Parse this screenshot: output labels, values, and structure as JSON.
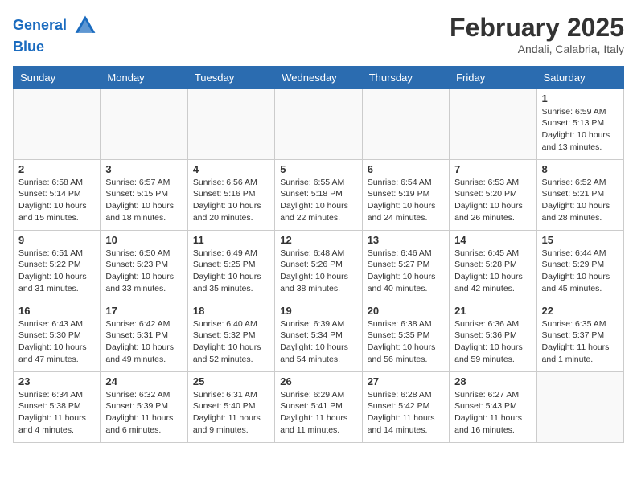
{
  "header": {
    "logo_line1": "General",
    "logo_line2": "Blue",
    "month_year": "February 2025",
    "location": "Andali, Calabria, Italy"
  },
  "days_of_week": [
    "Sunday",
    "Monday",
    "Tuesday",
    "Wednesday",
    "Thursday",
    "Friday",
    "Saturday"
  ],
  "weeks": [
    [
      {
        "day": "",
        "info": ""
      },
      {
        "day": "",
        "info": ""
      },
      {
        "day": "",
        "info": ""
      },
      {
        "day": "",
        "info": ""
      },
      {
        "day": "",
        "info": ""
      },
      {
        "day": "",
        "info": ""
      },
      {
        "day": "1",
        "info": "Sunrise: 6:59 AM\nSunset: 5:13 PM\nDaylight: 10 hours and 13 minutes."
      }
    ],
    [
      {
        "day": "2",
        "info": "Sunrise: 6:58 AM\nSunset: 5:14 PM\nDaylight: 10 hours and 15 minutes."
      },
      {
        "day": "3",
        "info": "Sunrise: 6:57 AM\nSunset: 5:15 PM\nDaylight: 10 hours and 18 minutes."
      },
      {
        "day": "4",
        "info": "Sunrise: 6:56 AM\nSunset: 5:16 PM\nDaylight: 10 hours and 20 minutes."
      },
      {
        "day": "5",
        "info": "Sunrise: 6:55 AM\nSunset: 5:18 PM\nDaylight: 10 hours and 22 minutes."
      },
      {
        "day": "6",
        "info": "Sunrise: 6:54 AM\nSunset: 5:19 PM\nDaylight: 10 hours and 24 minutes."
      },
      {
        "day": "7",
        "info": "Sunrise: 6:53 AM\nSunset: 5:20 PM\nDaylight: 10 hours and 26 minutes."
      },
      {
        "day": "8",
        "info": "Sunrise: 6:52 AM\nSunset: 5:21 PM\nDaylight: 10 hours and 28 minutes."
      }
    ],
    [
      {
        "day": "9",
        "info": "Sunrise: 6:51 AM\nSunset: 5:22 PM\nDaylight: 10 hours and 31 minutes."
      },
      {
        "day": "10",
        "info": "Sunrise: 6:50 AM\nSunset: 5:23 PM\nDaylight: 10 hours and 33 minutes."
      },
      {
        "day": "11",
        "info": "Sunrise: 6:49 AM\nSunset: 5:25 PM\nDaylight: 10 hours and 35 minutes."
      },
      {
        "day": "12",
        "info": "Sunrise: 6:48 AM\nSunset: 5:26 PM\nDaylight: 10 hours and 38 minutes."
      },
      {
        "day": "13",
        "info": "Sunrise: 6:46 AM\nSunset: 5:27 PM\nDaylight: 10 hours and 40 minutes."
      },
      {
        "day": "14",
        "info": "Sunrise: 6:45 AM\nSunset: 5:28 PM\nDaylight: 10 hours and 42 minutes."
      },
      {
        "day": "15",
        "info": "Sunrise: 6:44 AM\nSunset: 5:29 PM\nDaylight: 10 hours and 45 minutes."
      }
    ],
    [
      {
        "day": "16",
        "info": "Sunrise: 6:43 AM\nSunset: 5:30 PM\nDaylight: 10 hours and 47 minutes."
      },
      {
        "day": "17",
        "info": "Sunrise: 6:42 AM\nSunset: 5:31 PM\nDaylight: 10 hours and 49 minutes."
      },
      {
        "day": "18",
        "info": "Sunrise: 6:40 AM\nSunset: 5:32 PM\nDaylight: 10 hours and 52 minutes."
      },
      {
        "day": "19",
        "info": "Sunrise: 6:39 AM\nSunset: 5:34 PM\nDaylight: 10 hours and 54 minutes."
      },
      {
        "day": "20",
        "info": "Sunrise: 6:38 AM\nSunset: 5:35 PM\nDaylight: 10 hours and 56 minutes."
      },
      {
        "day": "21",
        "info": "Sunrise: 6:36 AM\nSunset: 5:36 PM\nDaylight: 10 hours and 59 minutes."
      },
      {
        "day": "22",
        "info": "Sunrise: 6:35 AM\nSunset: 5:37 PM\nDaylight: 11 hours and 1 minute."
      }
    ],
    [
      {
        "day": "23",
        "info": "Sunrise: 6:34 AM\nSunset: 5:38 PM\nDaylight: 11 hours and 4 minutes."
      },
      {
        "day": "24",
        "info": "Sunrise: 6:32 AM\nSunset: 5:39 PM\nDaylight: 11 hours and 6 minutes."
      },
      {
        "day": "25",
        "info": "Sunrise: 6:31 AM\nSunset: 5:40 PM\nDaylight: 11 hours and 9 minutes."
      },
      {
        "day": "26",
        "info": "Sunrise: 6:29 AM\nSunset: 5:41 PM\nDaylight: 11 hours and 11 minutes."
      },
      {
        "day": "27",
        "info": "Sunrise: 6:28 AM\nSunset: 5:42 PM\nDaylight: 11 hours and 14 minutes."
      },
      {
        "day": "28",
        "info": "Sunrise: 6:27 AM\nSunset: 5:43 PM\nDaylight: 11 hours and 16 minutes."
      },
      {
        "day": "",
        "info": ""
      }
    ]
  ]
}
